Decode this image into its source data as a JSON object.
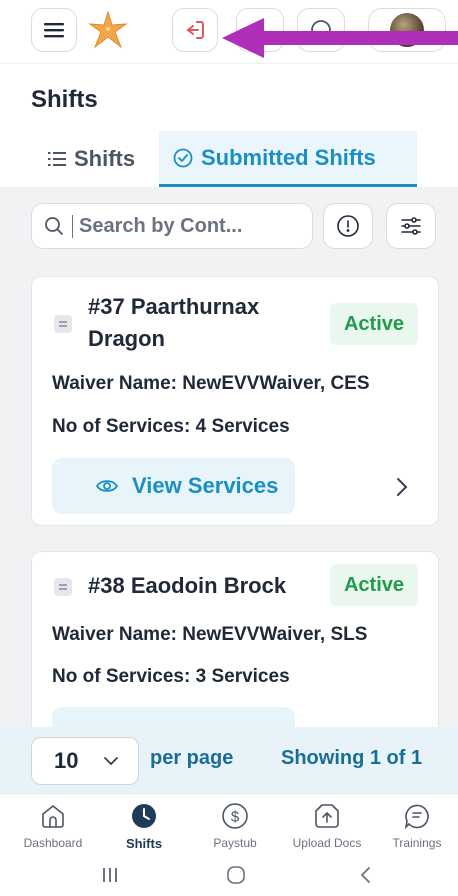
{
  "header": {
    "menu_icon": "hamburger-icon",
    "logo_icon": "starfish-logo-icon",
    "logout_icon": "logout-icon",
    "help_icon": "help-icon",
    "avatar_icon": "user-avatar"
  },
  "page": {
    "title": "Shifts"
  },
  "tabs": [
    {
      "label": "Shifts",
      "icon": "list-icon",
      "active": false
    },
    {
      "label": "Submitted Shifts",
      "icon": "check-circle-icon",
      "active": true
    }
  ],
  "search": {
    "placeholder": "Search by Cont..."
  },
  "labels": {
    "waiver": "Waiver Name:",
    "services": "No of Services:",
    "view_services": "View Services"
  },
  "shifts": [
    {
      "title_line1": "#37 Paarthurnax",
      "title_line2": "Dragon",
      "status": "Active",
      "waiver": "NewEVVWaiver, CES",
      "services": "4 Services"
    },
    {
      "title_line1": "#38 Eaodoin Brock",
      "title_line2": "",
      "status": "Active",
      "waiver": "NewEVVWaiver, SLS",
      "services": "3 Services"
    }
  ],
  "pager": {
    "page_size": "10",
    "per_page": "per page",
    "showing": "Showing 1 of 1"
  },
  "bottom_nav": [
    {
      "label": "Dashboard",
      "icon": "home-icon"
    },
    {
      "label": "Shifts",
      "icon": "clock-icon",
      "active": true
    },
    {
      "label": "Paystub",
      "icon": "dollar-icon"
    },
    {
      "label": "Upload Docs",
      "icon": "upload-icon"
    },
    {
      "label": "Trainings",
      "icon": "training-icon"
    }
  ],
  "colors": {
    "accent": "#1a8fc4",
    "active_badge_text": "#1f9d4d",
    "active_badge_bg": "#e9f7ee",
    "logout_red": "#e05a5a",
    "annotation_arrow": "#b02fb8"
  }
}
